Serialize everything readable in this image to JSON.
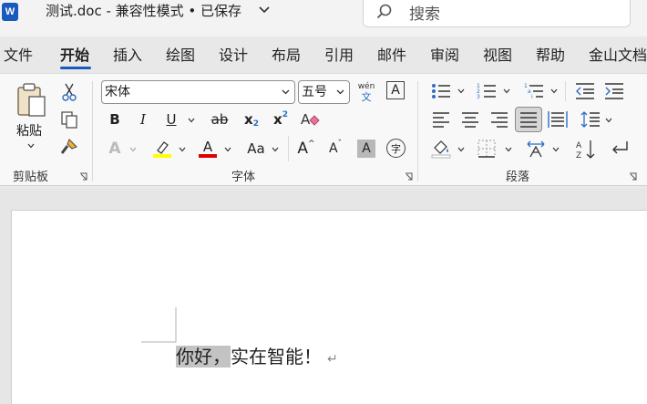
{
  "titlebar": {
    "app_letter": "W",
    "title": "测试.doc  -  兼容性模式 • 已保存",
    "search_placeholder": "搜索"
  },
  "tabs": [
    "文件",
    "开始",
    "插入",
    "绘图",
    "设计",
    "布局",
    "引用",
    "邮件",
    "审阅",
    "视图",
    "帮助",
    "金山文档"
  ],
  "active_tab": "开始",
  "ribbon": {
    "clipboard": {
      "label": "剪贴板",
      "paste_label": "粘贴"
    },
    "font": {
      "label": "字体",
      "font_name": "宋体",
      "font_size": "五号",
      "phonetic_top": "wén",
      "phonetic_bottom": "文",
      "clear_box": "A",
      "bold": "B",
      "italic": "I",
      "underline": "U",
      "strike": "ab",
      "subscript": "x",
      "subscript_mark": "2",
      "superscript": "x",
      "superscript_mark": "2",
      "effects": "A",
      "font_color": "A",
      "change_case": "Aa",
      "grow": "A",
      "shrink": "A",
      "shading": "A",
      "enclose": "字",
      "highlight_color": "#ffff00",
      "font_color_value": "#e00000"
    },
    "paragraph": {
      "label": "段落"
    }
  },
  "document": {
    "selected_text": "你好，",
    "rest_text": "实在智能！",
    "para_mark": "↵"
  }
}
